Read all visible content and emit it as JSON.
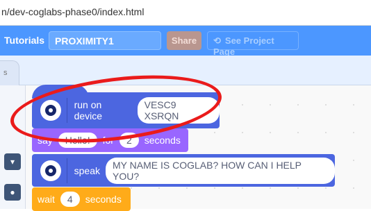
{
  "browser": {
    "url": "n/dev-coglabs-phase0/index.html"
  },
  "menubar": {
    "tutorials": "Tutorials",
    "project_title": "PROXIMITY1",
    "share": "Share",
    "see_project": "See Project Page"
  },
  "tabs": {
    "partial_tab": "s"
  },
  "blocks": {
    "run_on_device": {
      "label": "run on device",
      "value": "VESC9 XSRQN"
    },
    "say": {
      "label": "say",
      "message": "Hello!",
      "for_label": "for",
      "secs": "2",
      "seconds_label": "seconds"
    },
    "speak": {
      "label": "speak",
      "text": "MY NAME IS COGLAB? HOW CAN I HELP YOU?"
    },
    "wait": {
      "label": "wait",
      "secs": "4",
      "seconds_label": "seconds"
    }
  },
  "colors": {
    "menubar": "#4c97ff",
    "extension_block": "#4c66e0",
    "looks_block": "#9966ff",
    "control_block": "#ffab19",
    "annotation": "#ea1b1b"
  },
  "icons": {
    "see_project": "remix-arrows-icon",
    "extension": "robot-eye-icon",
    "palette_1": "chevron-down-icon",
    "palette_2": "extension-icon"
  }
}
